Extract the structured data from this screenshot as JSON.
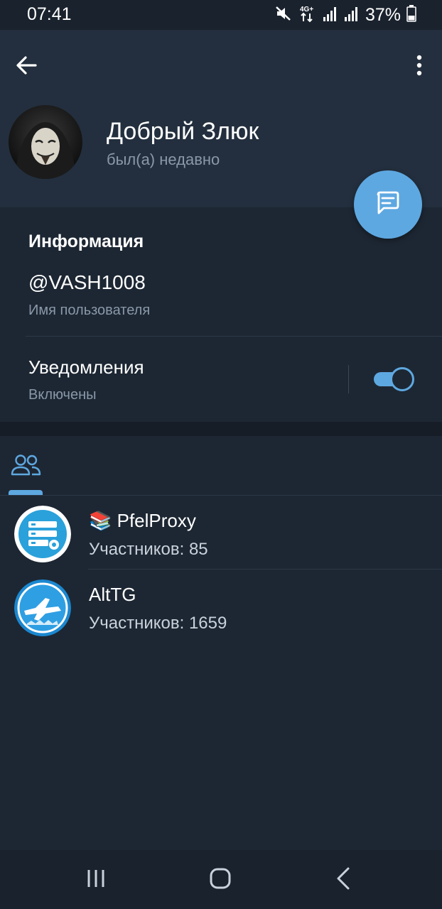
{
  "status_bar": {
    "time": "07:41",
    "network": "4G+",
    "battery": "37%",
    "icons": [
      "mute-icon",
      "network-4g-icon",
      "signal-icon",
      "signal-icon",
      "battery-icon"
    ]
  },
  "header": {
    "name": "Добрый Злюк",
    "status": "был(а) недавно"
  },
  "info": {
    "title": "Информация",
    "username": "@VASH1008",
    "username_label": "Имя пользователя",
    "notifications_label": "Уведомления",
    "notifications_state": "Включены",
    "notifications_enabled": true
  },
  "tabs": [
    {
      "icon": "members-icon",
      "active": true
    }
  ],
  "groups": [
    {
      "emoji": "📚",
      "name": "PfelProxy",
      "members": "Участников: 85"
    },
    {
      "emoji": "",
      "name": "AltTG",
      "members": "Участников: 1659"
    }
  ],
  "colors": {
    "accent": "#5ea8e1",
    "background": "#1d2733",
    "header": "#232f3e"
  }
}
